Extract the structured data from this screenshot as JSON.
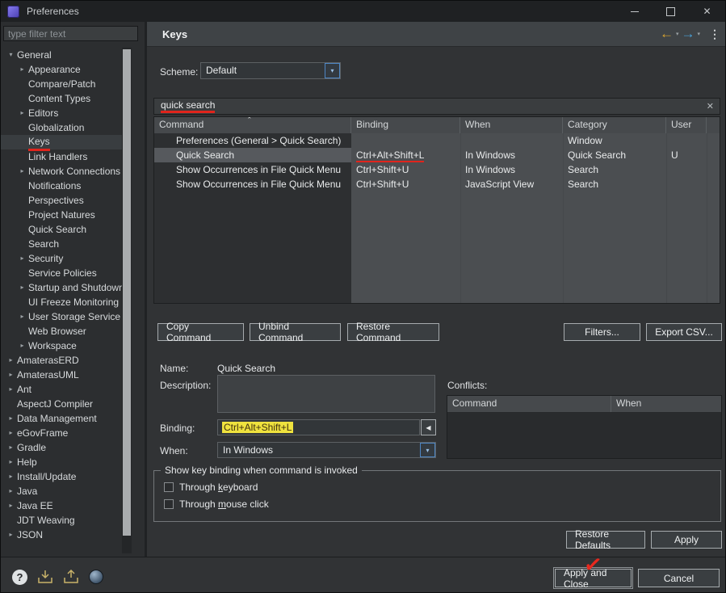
{
  "window": {
    "title": "Preferences"
  },
  "icons": {
    "tree_collapsed": "▸",
    "tree_expanded": "▾",
    "sort_asc": "ˆ",
    "search_clear": "✕",
    "combo_arrow": "▾",
    "nav_back": "←",
    "nav_forward": "→",
    "nav_caret": "▾",
    "overflow_menu": "⋮",
    "binding_reverse": "◀",
    "help": "?",
    "window_close": "✕",
    "annotation_check": "✓"
  },
  "sidebar": {
    "filter_placeholder": "type filter text",
    "tree": [
      {
        "label": "General",
        "level": 0,
        "expanded": true
      },
      {
        "label": "Appearance",
        "level": 1,
        "arrow": true
      },
      {
        "label": "Compare/Patch",
        "level": 1
      },
      {
        "label": "Content Types",
        "level": 1
      },
      {
        "label": "Editors",
        "level": 1,
        "arrow": true
      },
      {
        "label": "Globalization",
        "level": 1
      },
      {
        "label": "Keys",
        "level": 1,
        "selected": true,
        "annotated": true
      },
      {
        "label": "Link Handlers",
        "level": 1
      },
      {
        "label": "Network Connections",
        "level": 1,
        "arrow": true
      },
      {
        "label": "Notifications",
        "level": 1
      },
      {
        "label": "Perspectives",
        "level": 1
      },
      {
        "label": "Project Natures",
        "level": 1
      },
      {
        "label": "Quick Search",
        "level": 1
      },
      {
        "label": "Search",
        "level": 1
      },
      {
        "label": "Security",
        "level": 1,
        "arrow": true
      },
      {
        "label": "Service Policies",
        "level": 1
      },
      {
        "label": "Startup and Shutdown",
        "level": 1,
        "arrow": true
      },
      {
        "label": "UI Freeze Monitoring",
        "level": 1
      },
      {
        "label": "User Storage Service",
        "level": 1,
        "arrow": true
      },
      {
        "label": "Web Browser",
        "level": 1
      },
      {
        "label": "Workspace",
        "level": 1,
        "arrow": true
      },
      {
        "label": "AmaterasERD",
        "level": 0,
        "arrow": true
      },
      {
        "label": "AmaterasUML",
        "level": 0,
        "arrow": true
      },
      {
        "label": "Ant",
        "level": 0,
        "arrow": true
      },
      {
        "label": "AspectJ Compiler",
        "level": 0
      },
      {
        "label": "Data Management",
        "level": 0,
        "arrow": true
      },
      {
        "label": "eGovFrame",
        "level": 0,
        "arrow": true
      },
      {
        "label": "Gradle",
        "level": 0,
        "arrow": true
      },
      {
        "label": "Help",
        "level": 0,
        "arrow": true
      },
      {
        "label": "Install/Update",
        "level": 0,
        "arrow": true
      },
      {
        "label": "Java",
        "level": 0,
        "arrow": true
      },
      {
        "label": "Java EE",
        "level": 0,
        "arrow": true
      },
      {
        "label": "JDT Weaving",
        "level": 0
      },
      {
        "label": "JSON",
        "level": 0,
        "arrow": true
      }
    ]
  },
  "header": {
    "title": "Keys"
  },
  "scheme": {
    "label": "Scheme:",
    "value": "Default"
  },
  "search": {
    "value": "quick search"
  },
  "table": {
    "columns": [
      "Command",
      "Binding",
      "When",
      "Category",
      "User"
    ],
    "rows": [
      {
        "command": "Preferences (General > Quick Search)",
        "binding": "",
        "when": "",
        "category": "Window",
        "user": ""
      },
      {
        "command": "Quick Search",
        "binding": "Ctrl+Alt+Shift+L",
        "when": "In Windows",
        "category": "Quick Search",
        "user": "U",
        "selected": true,
        "binding_annotated": true
      },
      {
        "command": "Show Occurrences in File Quick Menu",
        "binding": "Ctrl+Shift+U",
        "when": "In Windows",
        "category": "Search",
        "user": ""
      },
      {
        "command": "Show Occurrences in File Quick Menu",
        "binding": "Ctrl+Shift+U",
        "when": "JavaScript View",
        "category": "Search",
        "user": ""
      }
    ]
  },
  "actions": {
    "copy": "Copy Command",
    "unbind": "Unbind Command",
    "restore": "Restore Command",
    "filters": "Filters...",
    "export": "Export CSV..."
  },
  "detail": {
    "name_label": "Name:",
    "name_value": "Quick Search",
    "description_label": "Description:",
    "binding_label": "Binding:",
    "binding_value": "Ctrl+Alt+Shift+L",
    "when_label": "When:",
    "when_value": "In Windows"
  },
  "conflicts": {
    "label": "Conflicts:",
    "columns": [
      "Command",
      "When"
    ]
  },
  "invoke_group": {
    "title": "Show key binding when command is invoked",
    "keyboard": {
      "pre": "Through ",
      "key": "k",
      "post": "eyboard"
    },
    "mouse": {
      "pre": "Through ",
      "key": "m",
      "post": "ouse click"
    }
  },
  "page_buttons": {
    "restore_defaults": "Restore Defaults",
    "apply": "Apply"
  },
  "dialog_buttons": {
    "apply_close": "Apply and Close",
    "cancel": "Cancel"
  }
}
